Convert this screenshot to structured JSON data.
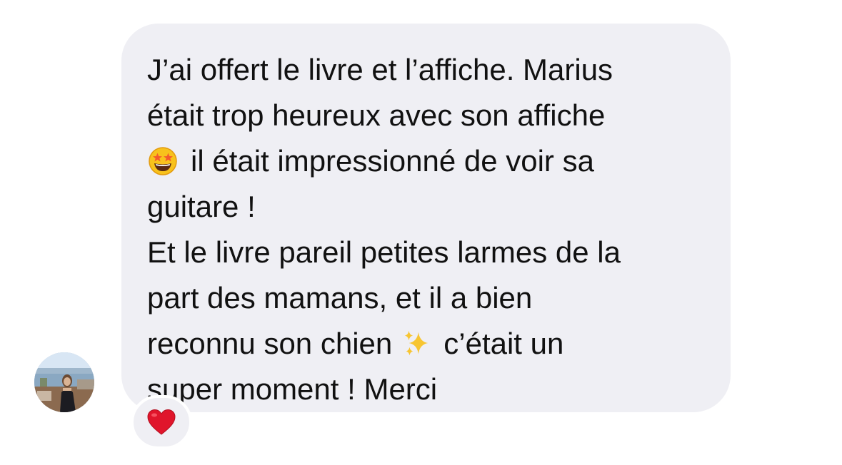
{
  "message": {
    "lines": [
      "J’ai offert le livre et l’affiche. Marius",
      "était trop heureux avec son affiche",
      "il était impressionné de voir sa",
      "guitare !",
      "Et le livre pareil petites larmes de la",
      "part des mamans, et il a bien",
      "reconnu son chien",
      "c’était un",
      "super moment ! Merci"
    ],
    "emojis": {
      "star_struck": "star-struck-emoji",
      "sparkles": "sparkles-emoji"
    }
  },
  "reaction": {
    "icon": "red-heart-icon",
    "color": "#e0152b"
  },
  "colors": {
    "bubble": "#efeff4",
    "text": "#111111"
  }
}
